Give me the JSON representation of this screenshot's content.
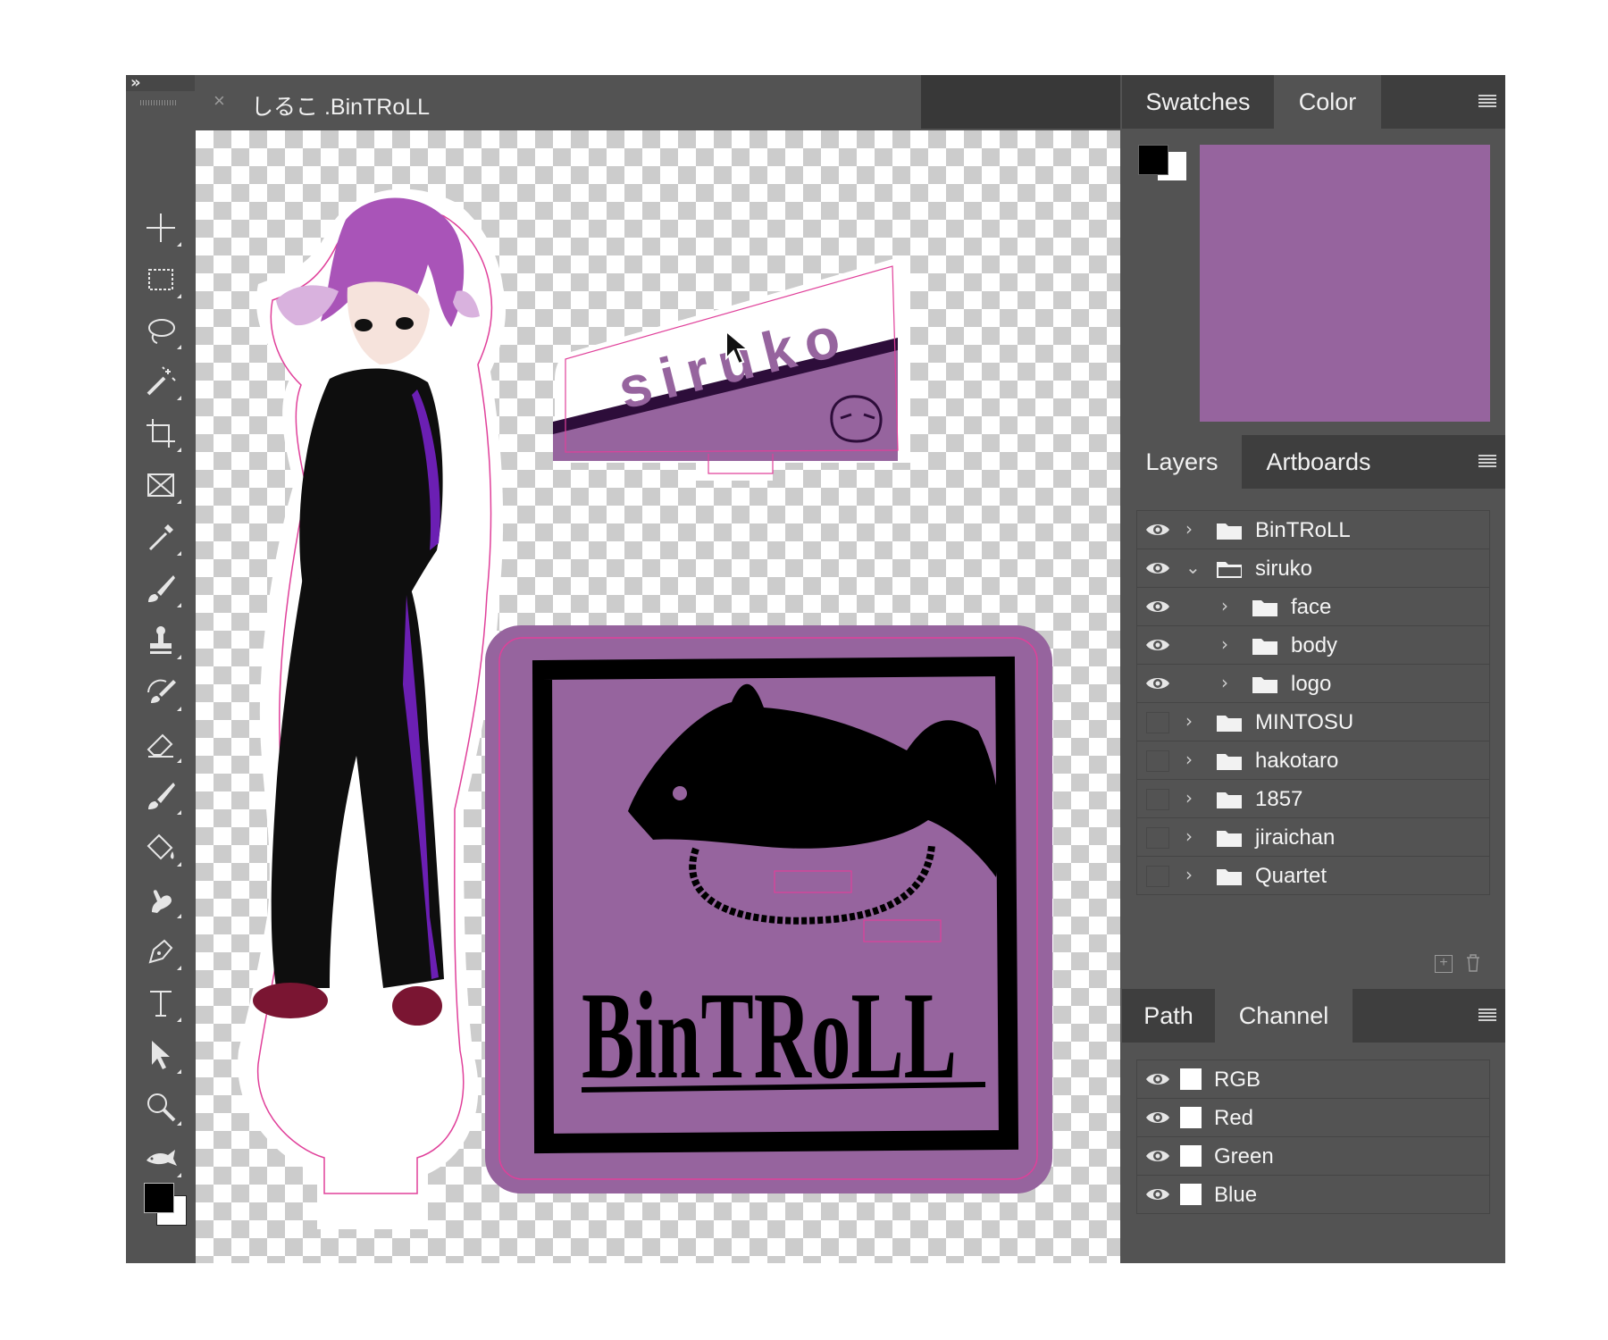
{
  "document": {
    "tab_title": "しるこ .BinTRoLL",
    "close_symbol": "×"
  },
  "artwork": {
    "nameplate_text": "siruko",
    "logo_text": "BinTRoLL",
    "accent_color": "#96649e",
    "outline_color": "#e0409a"
  },
  "toolbar": {
    "collapse_symbol": "»",
    "tools": [
      "move-tool",
      "marquee-tool",
      "lasso-tool",
      "magic-wand-tool",
      "crop-tool",
      "frame-tool",
      "eyedropper-tool",
      "brush-tool",
      "clone-stamp-tool",
      "history-brush-tool",
      "eraser-tool",
      "smudge-brush-tool",
      "paint-bucket-tool",
      "finger-tool",
      "pen-tool",
      "type-tool",
      "path-selection-tool",
      "zoom-tool",
      "custom-fish-tool"
    ],
    "foreground_color": "#000000",
    "background_color": "#ffffff"
  },
  "color_panel": {
    "tabs": [
      "Swatches",
      "Color"
    ],
    "active_tab": "Color",
    "current_color": "#96649e"
  },
  "layers_panel": {
    "tabs": [
      "Layers",
      "Artboards"
    ],
    "active_tab": "Layers",
    "layers": [
      {
        "name": "BinTRoLL",
        "visible": true,
        "expanded": false,
        "indent": 0
      },
      {
        "name": "siruko",
        "visible": true,
        "expanded": true,
        "indent": 0
      },
      {
        "name": "face",
        "visible": true,
        "expanded": false,
        "indent": 1
      },
      {
        "name": "body",
        "visible": true,
        "expanded": false,
        "indent": 1
      },
      {
        "name": "logo",
        "visible": true,
        "expanded": false,
        "indent": 1
      },
      {
        "name": "MINTOSU",
        "visible": false,
        "expanded": false,
        "indent": 0
      },
      {
        "name": "hakotaro",
        "visible": false,
        "expanded": false,
        "indent": 0
      },
      {
        "name": "1857",
        "visible": false,
        "expanded": false,
        "indent": 0
      },
      {
        "name": "jiraichan",
        "visible": false,
        "expanded": false,
        "indent": 0
      },
      {
        "name": "Quartet",
        "visible": false,
        "expanded": false,
        "indent": 0
      }
    ]
  },
  "channels_panel": {
    "tabs": [
      "Path",
      "Channel"
    ],
    "active_tab": "Channel",
    "channels": [
      {
        "name": "RGB",
        "visible": true
      },
      {
        "name": "Red",
        "visible": true
      },
      {
        "name": "Green",
        "visible": true
      },
      {
        "name": "Blue",
        "visible": true
      }
    ]
  }
}
